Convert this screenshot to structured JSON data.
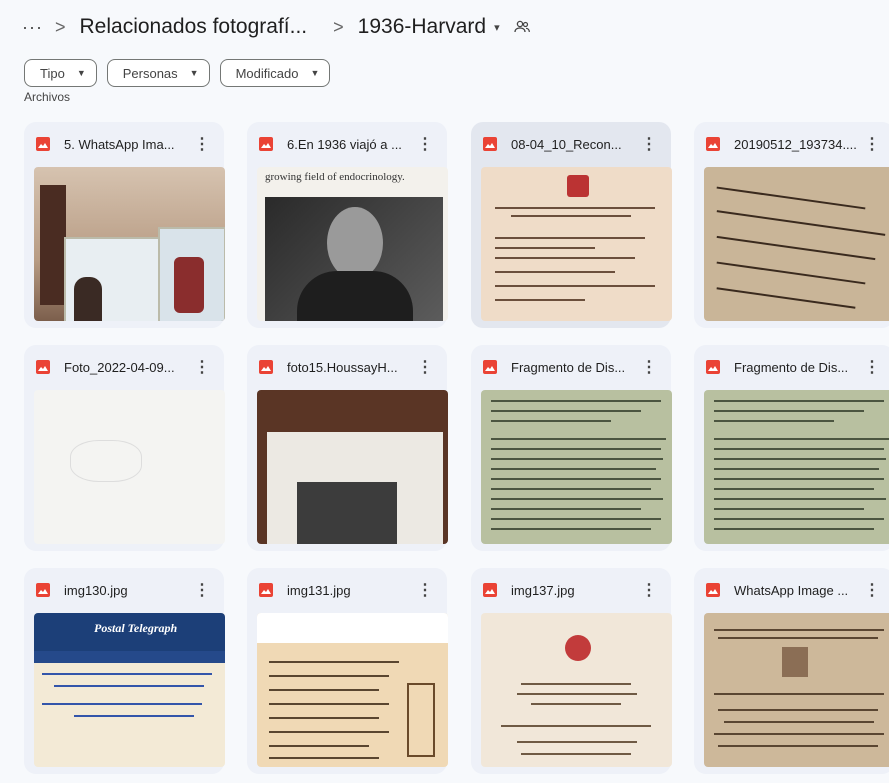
{
  "breadcrumb": {
    "more": "···",
    "sep": ">",
    "parent": "Relacionados fotografí...",
    "current": "1936-Harvard",
    "caret": "▾"
  },
  "filters": [
    {
      "label": "Tipo"
    },
    {
      "label": "Personas"
    },
    {
      "label": "Modificado"
    }
  ],
  "section_label": "Archivos",
  "more_glyph": "⋮",
  "files": [
    {
      "title": "5. WhatsApp Ima...",
      "thumb": "museum"
    },
    {
      "title": "6.En 1936 viajó a ...",
      "thumb": "portrait",
      "caption": "growing field of endocrinology."
    },
    {
      "title": "08-04_10_Recon...",
      "thumb": "letter",
      "selected": true
    },
    {
      "title": "20190512_193734....",
      "thumb": "hand"
    },
    {
      "title": "Foto_2022-04-09...",
      "thumb": "blank"
    },
    {
      "title": "foto15.HoussayH...",
      "thumb": "book"
    },
    {
      "title": "Fragmento de Dis...",
      "thumb": "typed"
    },
    {
      "title": "Fragmento de Dis...",
      "thumb": "typed"
    },
    {
      "title": "img130.jpg",
      "thumb": "telegram",
      "caption": "Postal Telegraph"
    },
    {
      "title": "img131.jpg",
      "thumb": "program"
    },
    {
      "title": "img137.jpg",
      "thumb": "cert"
    },
    {
      "title": "WhatsApp Image ...",
      "thumb": "cert2"
    }
  ]
}
